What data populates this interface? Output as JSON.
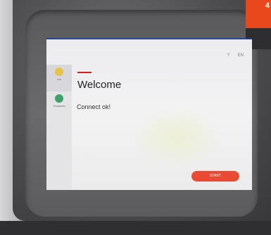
{
  "badge": {
    "text": "4"
  },
  "topbar": {
    "help": "?",
    "language": "EN"
  },
  "sidebar": {
    "items": [
      {
        "label": "xxx",
        "icon": "coin-icon",
        "color": "#e8c24a"
      },
      {
        "label": "Channels",
        "icon": "globe-icon",
        "color": "#3fa06a"
      }
    ]
  },
  "main": {
    "title": "Welcome",
    "status": "Connect ok!",
    "start_label": "START"
  },
  "colors": {
    "accent": "#d62020",
    "start_button": "#e84a33",
    "badge": "#e8481c"
  }
}
